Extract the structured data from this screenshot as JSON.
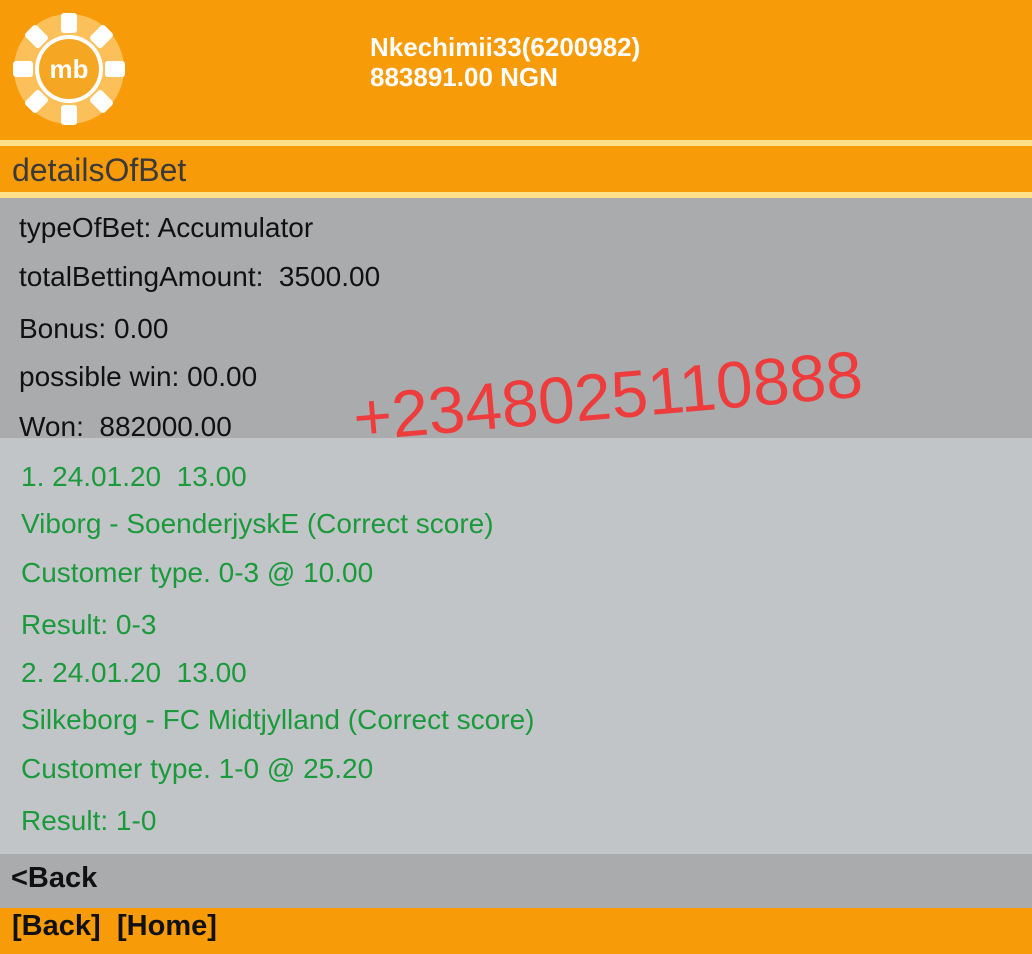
{
  "header": {
    "logo_text": "mb",
    "account_line": "Nkechimii33(6200982)",
    "balance_line": "883891.00 NGN"
  },
  "page": {
    "title": "detailsOfBet"
  },
  "summary": {
    "type_of_bet": "typeOfBet: Accumulator",
    "total_betting_amount": "totalBettingAmount:  3500.00",
    "bonus": "Bonus: 0.00",
    "possible_win": "possible win: 00.00",
    "won": "Won:  882000.00"
  },
  "bets": [
    {
      "date_line": "1. 24.01.20  13.00",
      "match_line": "Viborg - SoenderjyskE (Correct score)",
      "pick_line": "Customer type. 0-3 @ 10.00",
      "result_line": "Result: 0-3"
    },
    {
      "date_line": "2. 24.01.20  13.00",
      "match_line": "Silkeborg - FC Midtjylland (Correct score)",
      "pick_line": "Customer type. 1-0 @ 25.20",
      "result_line": "Result: 1-0"
    }
  ],
  "watermark": "+2348025110888",
  "nav": {
    "back_link": "<Back",
    "footer_back": "[Back]",
    "footer_home": "[Home]"
  },
  "colors": {
    "brand_orange": "#f79b09",
    "stripe_yellow": "#ffe08a",
    "summary_bg": "#a9abad",
    "body_bg": "#c2c5c8",
    "match_text": "#1b9a3c",
    "watermark": "#ee3b3b"
  }
}
